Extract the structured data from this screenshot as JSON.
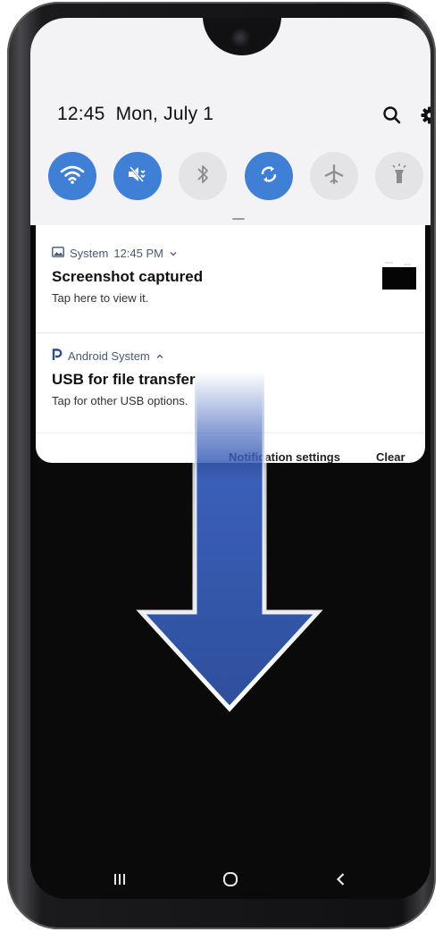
{
  "status_bar": {
    "time": "12:45",
    "date": "Mon, July 1",
    "icons": [
      "search-icon",
      "gear-icon"
    ]
  },
  "quick_settings": [
    {
      "icon": "wifi-icon",
      "state": "on"
    },
    {
      "icon": "mute-icon",
      "state": "on"
    },
    {
      "icon": "bluetooth-icon",
      "state": "off"
    },
    {
      "icon": "auto-rotate-icon",
      "state": "on"
    },
    {
      "icon": "airplane-icon",
      "state": "off"
    },
    {
      "icon": "flashlight-icon",
      "state": "off"
    }
  ],
  "notifications": [
    {
      "app": "System",
      "time": "12:45 PM",
      "app_icon": "image-icon",
      "title": "Screenshot captured",
      "body": "Tap here to view it."
    },
    {
      "app": "Android System",
      "app_icon": "android-system-icon",
      "title": "USB for file transfer",
      "body": "Tap for other USB options."
    }
  ],
  "actions": {
    "settings_label": "Notification settings",
    "clear_label": "Clear"
  },
  "nav_bar": [
    "recents-icon",
    "home-icon",
    "back-icon"
  ],
  "colors": {
    "accent": "#3f7fd6",
    "arrow": "#3a5fb8"
  }
}
